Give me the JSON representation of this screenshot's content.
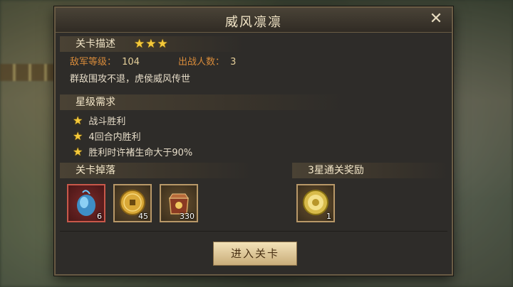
{
  "dialog": {
    "title": "威风凛凛",
    "close_icon": "close-icon"
  },
  "level_desc": {
    "header": "关卡描述",
    "stars": "★★★",
    "enemy_level_label": "敌军等级：",
    "enemy_level_value": "104",
    "troop_count_label": "出战人数：",
    "troop_count_value": "3",
    "description": "群敌围攻不退，虎侯威风传世"
  },
  "star_requirements": {
    "header": "星级需求",
    "items": [
      "战斗胜利",
      "4回合内胜利",
      "胜利时许褚生命大于90%"
    ]
  },
  "drops": {
    "header": "关卡掉落",
    "items": [
      {
        "icon": "blue-gem-icon",
        "count": "6"
      },
      {
        "icon": "gold-coin-icon",
        "count": "45"
      },
      {
        "icon": "treasure-bag-icon",
        "count": "330"
      }
    ]
  },
  "reward": {
    "header": "3星通关奖励",
    "items": [
      {
        "icon": "gold-medal-icon",
        "count": "1"
      }
    ]
  },
  "enter_button": "进入关卡",
  "colors": {
    "accent_star": "#f5c93a",
    "label_orange": "#d88b3a",
    "panel_bg": "#2e2c29"
  }
}
